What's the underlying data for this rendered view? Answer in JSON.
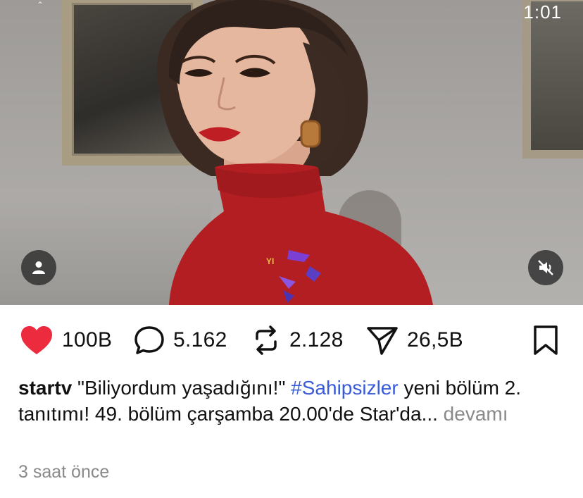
{
  "status": {
    "time": "1:01"
  },
  "video": {
    "user_button_icon": "user-icon",
    "mute_button_icon": "speaker-muted-icon",
    "logo_text": "YI"
  },
  "actions": {
    "like": {
      "icon": "heart-icon",
      "count": "100B",
      "color": "#ed2b3f"
    },
    "comment": {
      "icon": "comment-bubble-icon",
      "count": "5.162"
    },
    "repost": {
      "icon": "repost-icon",
      "count": "2.128"
    },
    "share": {
      "icon": "send-icon",
      "count": "26,5B"
    },
    "save": {
      "icon": "bookmark-icon"
    }
  },
  "post": {
    "username": "startv",
    "caption_text": "\"Biliyordum yaşadığını!\" ",
    "hashtag": "#Sahipsizler",
    "caption_rest": " yeni bölüm 2. tanıtımı! 49. bölüm çarşamba 20.00'de Star'da...",
    "more_label": " devamı",
    "timestamp": "3 saat önce",
    "hashtag_color": "#3a5bd9"
  }
}
